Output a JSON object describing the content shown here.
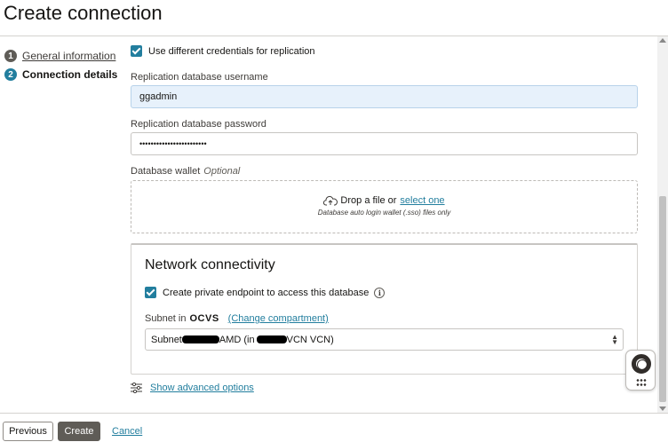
{
  "header": {
    "title": "Create connection"
  },
  "steps": [
    {
      "number": "1",
      "label": "General information"
    },
    {
      "number": "2",
      "label": "Connection details"
    }
  ],
  "form": {
    "use_different_credentials": {
      "label": "Use different credentials for replication",
      "checked": true
    },
    "replication_username": {
      "label": "Replication database username",
      "value": "ggadmin"
    },
    "replication_password": {
      "label": "Replication database password",
      "value": "••••••••••••••••••••••••"
    },
    "wallet": {
      "label": "Database wallet",
      "optional": "Optional",
      "drop_text": "Drop a file or",
      "select_link": "select one",
      "hint": "Database auto login wallet (.sso) files only"
    }
  },
  "network": {
    "title": "Network connectivity",
    "private_endpoint": {
      "label": "Create private endpoint to access this database",
      "checked": true
    },
    "subnet_label": "Subnet in",
    "compartment": "OCVS",
    "change_compartment": "(Change compartment)",
    "subnet_value": {
      "prefix": "Subnet",
      "middle": "AMD (in",
      "suffix": "VCN VCN)"
    }
  },
  "advanced_options": "Show advanced options",
  "footer": {
    "previous": "Previous",
    "create": "Create",
    "cancel": "Cancel"
  },
  "colors": {
    "accent": "#227e9e",
    "primary_button": "#5f5c57",
    "filled_input": "#e7f1fb"
  }
}
